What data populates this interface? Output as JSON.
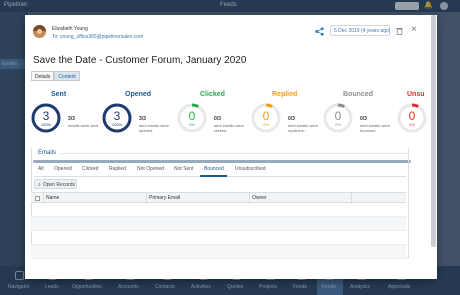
{
  "app": {
    "logo": "Pipeliner",
    "window_title": "Feeds",
    "sidebar_items": [
      "",
      "",
      "",
      "Emails",
      "",
      "",
      "",
      "",
      "",
      "",
      "",
      ""
    ],
    "bottom_nav": [
      "Navigator",
      "Leads",
      "Opportunities",
      "Accounts",
      "Contacts",
      "Activities",
      "Quotes",
      "Projects",
      "Feeds",
      "Feeds",
      "Analytics",
      "Approvals"
    ]
  },
  "email": {
    "sender_name": "Elizabeth Young",
    "to_line": "To: young_office365@pipelinersales.com",
    "date": "5 Dec 2019 (4 years ago)",
    "subject": "Save the Date - Customer Forum, January 2020"
  },
  "view_tabs": [
    {
      "label": "Details",
      "active": false
    },
    {
      "label": "Content",
      "active": true
    }
  ],
  "stats": [
    {
      "label": "Sent",
      "color": "#1b5a96",
      "value": "3",
      "pct": "100%",
      "count": "3/3",
      "desc": "emails were sent",
      "fraction": 1.0
    },
    {
      "label": "Opened",
      "color": "#1b5a96",
      "value": "3",
      "pct": "100%",
      "count": "3/3",
      "desc": "sent emails were opened",
      "fraction": 1.0
    },
    {
      "label": "Clicked",
      "color": "#2fa84f",
      "value": "0",
      "pct": "0%",
      "count": "0/3",
      "desc": "sent emails were clicked",
      "fraction": 0
    },
    {
      "label": "Replied",
      "color": "#f39c12",
      "value": "0",
      "pct": "0%",
      "count": "0/3",
      "desc": "sent emails were replied to",
      "fraction": 0
    },
    {
      "label": "Bounced",
      "color": "#8a8f94",
      "value": "0",
      "pct": "0%",
      "count": "0/3",
      "desc": "sent emails were bounced",
      "fraction": 0
    },
    {
      "label": "Unsu",
      "color": "#d9342b",
      "value": "0",
      "pct": "0%",
      "count": "",
      "desc": "",
      "fraction": 0
    }
  ],
  "emails_section": {
    "legend": "Emails",
    "filters": [
      "All",
      "Opened",
      "Clicked",
      "Replied",
      "Not Opened",
      "Not Sent",
      "Bounced",
      "Unsubscribed"
    ],
    "active_filter": "Bounced",
    "open_records_label": "Open Records",
    "columns": [
      "Name",
      "Primary Email",
      "Owner"
    ]
  }
}
